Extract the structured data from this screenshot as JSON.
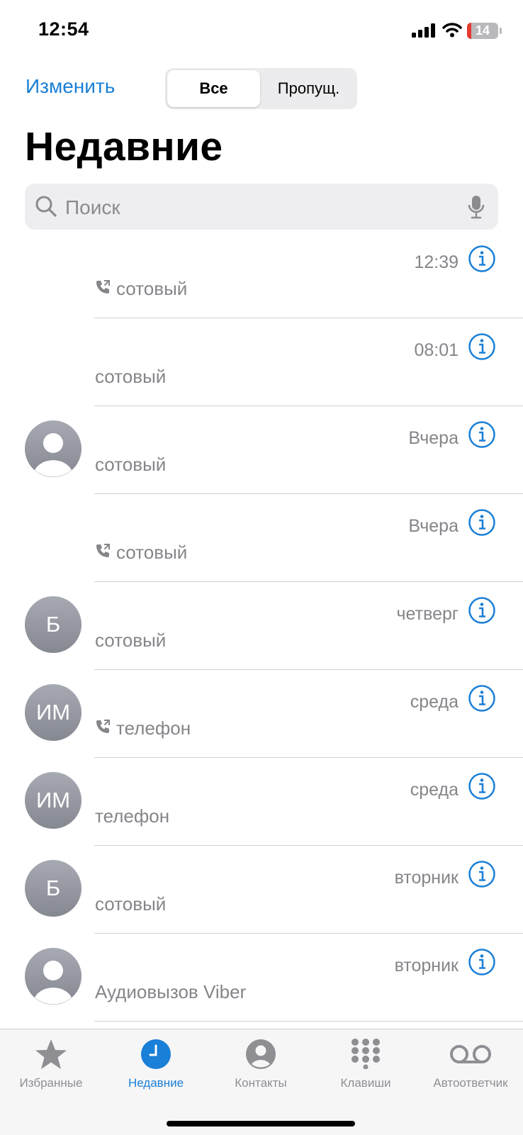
{
  "status_bar": {
    "time": "12:54",
    "battery": "14",
    "battery_level": 0.14
  },
  "header": {
    "edit_label": "Изменить",
    "segments": [
      "Все",
      "Пропущ."
    ],
    "title": "Недавние"
  },
  "search": {
    "placeholder": "Поиск"
  },
  "calls": [
    {
      "avatar": "none",
      "initials": "",
      "type": "сотовый",
      "outgoing": true,
      "time": "12:39"
    },
    {
      "avatar": "none",
      "initials": "",
      "type": "сотовый",
      "outgoing": false,
      "time": "08:01"
    },
    {
      "avatar": "person",
      "initials": "",
      "type": "сотовый",
      "outgoing": false,
      "time": "Вчера"
    },
    {
      "avatar": "none",
      "initials": "",
      "type": "сотовый",
      "outgoing": true,
      "time": "Вчера"
    },
    {
      "avatar": "initials",
      "initials": "Б",
      "type": "сотовый",
      "outgoing": false,
      "time": "четверг"
    },
    {
      "avatar": "initials",
      "initials": "ИМ",
      "type": "телефон",
      "outgoing": true,
      "time": "среда"
    },
    {
      "avatar": "initials",
      "initials": "ИМ",
      "type": "телефон",
      "outgoing": false,
      "time": "среда"
    },
    {
      "avatar": "initials",
      "initials": "Б",
      "type": "сотовый",
      "outgoing": false,
      "time": "вторник"
    },
    {
      "avatar": "person",
      "initials": "",
      "type": "Аудиовызов Viber",
      "outgoing": false,
      "time": "вторник"
    }
  ],
  "tab_bar": {
    "tabs": [
      {
        "label": "Избранные",
        "icon": "star-icon",
        "active": false
      },
      {
        "label": "Недавние",
        "icon": "clock-icon",
        "active": true
      },
      {
        "label": "Контакты",
        "icon": "person-circle-icon",
        "active": false
      },
      {
        "label": "Клавиши",
        "icon": "keypad-icon",
        "active": false
      },
      {
        "label": "Автоответчик",
        "icon": "voicemail-icon",
        "active": false
      }
    ]
  },
  "colors": {
    "accent": "#1a7fd6",
    "secondary_text": "#85858a",
    "battery_low": "#e5392e"
  }
}
